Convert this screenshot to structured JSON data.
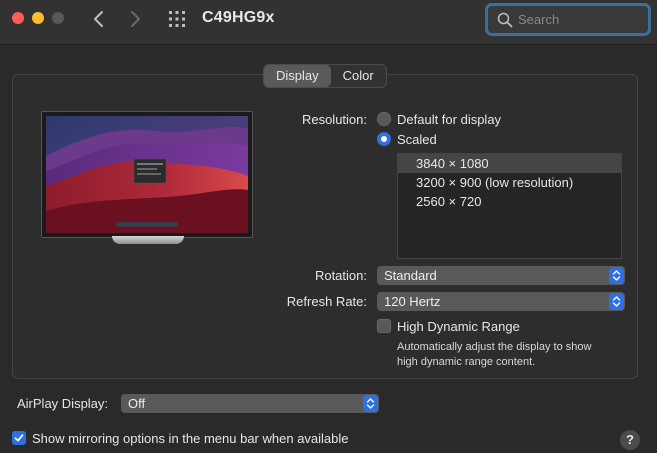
{
  "window": {
    "title": "C49HG9x"
  },
  "search": {
    "placeholder": "Search"
  },
  "tabs": [
    {
      "label": "Display"
    },
    {
      "label": "Color"
    }
  ],
  "resolution": {
    "label": "Resolution:",
    "options": [
      {
        "label": "Default for display"
      },
      {
        "label": "Scaled"
      }
    ],
    "scaled_list": [
      "3840 × 1080",
      "3200 × 900 (low resolution)",
      "2560 × 720"
    ]
  },
  "rotation": {
    "label": "Rotation:",
    "value": "Standard"
  },
  "refresh": {
    "label": "Refresh Rate:",
    "value": "120 Hertz"
  },
  "hdr": {
    "label": "High Dynamic Range",
    "note_line1": "Automatically adjust the display to show",
    "note_line2": "high dynamic range content."
  },
  "airplay": {
    "label": "AirPlay Display:",
    "value": "Off"
  },
  "mirroring": {
    "label": "Show mirroring options in the menu bar when available"
  },
  "help": {
    "label": "?"
  },
  "colors": {
    "accent": "#2f6fe0",
    "focus_ring": "#3c6f9c"
  }
}
